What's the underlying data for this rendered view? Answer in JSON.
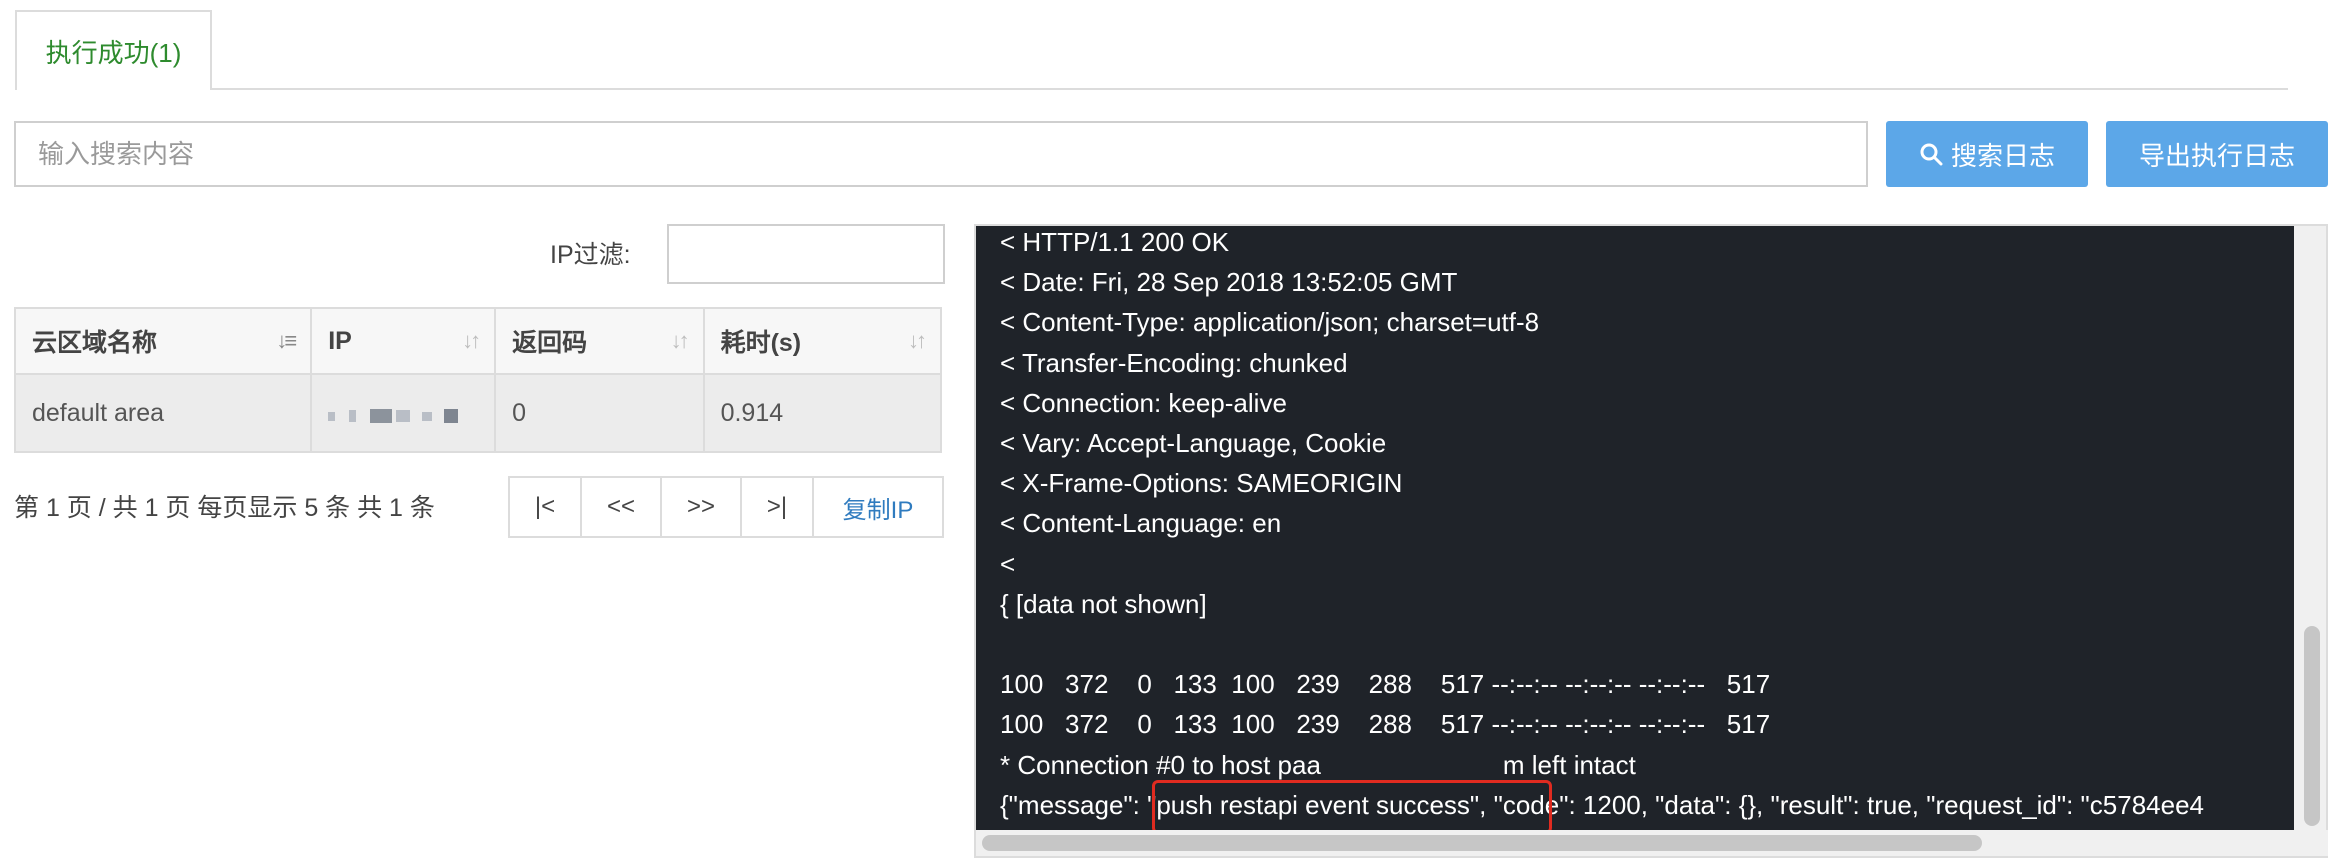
{
  "tabs": {
    "active_label": "执行成功(1)"
  },
  "search": {
    "placeholder": "输入搜索内容",
    "search_button": "搜索日志",
    "export_button": "导出执行日志"
  },
  "ip_filter": {
    "label": "IP过滤:",
    "value": ""
  },
  "table": {
    "headers": [
      "云区域名称",
      "IP",
      "返回码",
      "耗时(s)"
    ],
    "rows": [
      {
        "area": "default area",
        "ip": "",
        "code": "0",
        "time": "0.914"
      }
    ]
  },
  "pager": {
    "summary": "第 1 页 / 共 1 页  每页显示 5 条  共 1 条",
    "first": "|<",
    "prev": "<<",
    "next": ">>",
    "last": ">|",
    "copy_ip": "复制IP"
  },
  "log": {
    "text": "< HTTP/1.1 200 OK\n< Date: Fri, 28 Sep 2018 13:52:05 GMT\n< Content-Type: application/json; charset=utf-8\n< Transfer-Encoding: chunked\n< Connection: keep-alive\n< Vary: Accept-Language, Cookie\n< X-Frame-Options: SAMEORIGIN\n< Content-Language: en\n<\n{ [data not shown]\n\n100   372    0   133  100   239    288    517 --:--:-- --:--:-- --:--:--   517\n100   372    0   133  100   239    288    517 --:--:-- --:--:-- --:--:--   517\n* Connection #0 to host paa       m left intact\n{\"message\": \"push restapi event success\", \"code\": 1200, \"data\": {}, \"result\": true, \"request_id\": \"c5784ee4"
  },
  "colors": {
    "accent": "#5ca7e8",
    "tab_active": "#2e8b2e",
    "highlight": "#e02b20",
    "terminal_bg": "#1f2329"
  }
}
